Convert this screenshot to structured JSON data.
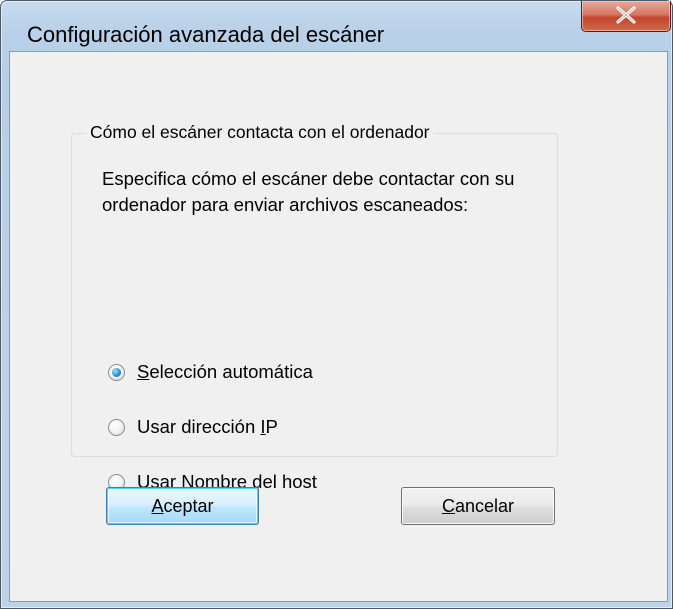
{
  "window": {
    "title": "Configuración avanzada del escáner",
    "close_label": "X"
  },
  "group": {
    "legend": "Cómo el escáner contacta con el ordenador",
    "description": "Especifica cómo el escáner debe contactar con su ordenador para enviar archivos escaneados:",
    "options": [
      {
        "label_pre": "",
        "label_u": "S",
        "label_post": "elección automática",
        "checked": true
      },
      {
        "label_pre": "Usar dirección ",
        "label_u": "I",
        "label_post": "P",
        "checked": false
      },
      {
        "label_pre": "Usar ",
        "label_u": "N",
        "label_post": "ombre del host",
        "checked": false
      }
    ]
  },
  "buttons": {
    "ok": {
      "label_u": "A",
      "label_post": "ceptar"
    },
    "cancel": {
      "label_u": "C",
      "label_post": "ancelar"
    }
  },
  "colors": {
    "frame": "#b9d0e8",
    "client": "#f0f0f0",
    "close_button": "#c2452c",
    "radio_checked": "#2f8fd6",
    "default_button_border": "#3c7fb1"
  }
}
